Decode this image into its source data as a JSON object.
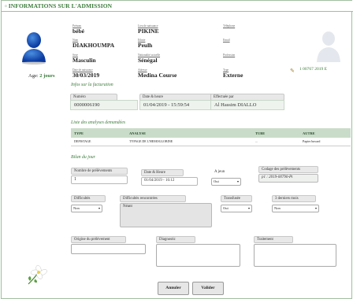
{
  "header": {
    "title": "INFORMATIONS SUR L'ADMISSION",
    "marker": "▫"
  },
  "patient": {
    "age_label": "Age:",
    "age_value": "2 jours",
    "ident_code": "1 00767 2019 E",
    "fields": [
      {
        "label": "Prénom",
        "value": "bébé"
      },
      {
        "label": "Lieu de naissance",
        "value": "PIKINE"
      },
      {
        "label": "Téléphone",
        "value": ""
      },
      {
        "label": "Nom",
        "value": "DIAKHOUMPA"
      },
      {
        "label": "Ethnie",
        "value": "Peulh"
      },
      {
        "label": "Email",
        "value": ""
      },
      {
        "label": "Sexe",
        "value": "Masculin"
      },
      {
        "label": "Nationalité actuelle",
        "value": "Sénégal"
      },
      {
        "label": "Profession",
        "value": ""
      },
      {
        "label": "Date de naissance",
        "value": "30/03/2019"
      },
      {
        "label": "Adresse",
        "value": "Medina Course"
      },
      {
        "label": "Type",
        "value": "Externe"
      }
    ]
  },
  "facturation": {
    "section_title": "Infos sur la facturation",
    "numero_label": "Numéro",
    "numero_value": "0000006190",
    "date_label": "Date & heure",
    "date_value": "01/04/2019 - 15:59:54",
    "effectue_label": "Effectuée par",
    "effectue_value": "Al Hassim DIALLO"
  },
  "analyses": {
    "section_title": "Liste des analyses demandées",
    "columns": [
      "TYPE",
      "ANALYSE",
      "TUBE",
      "AUTRE"
    ],
    "rows": [
      [
        "DEPISTAGE",
        "TYPAGE DE L'HEMOGLOBINE",
        "...",
        "Papier buvard"
      ]
    ]
  },
  "bilan": {
    "section_title": "Bilan du jour",
    "nombre_label": "Nombre de prélèvements",
    "nombre_value": "1",
    "date_label": "Date & Heure",
    "date_value": "01/04/2019 - 16:12",
    "ajeun_label": "A jeun",
    "ajeun_value": "Oui",
    "codage_label": "Codage des prélèvements",
    "codage_value": "p1 : 2019-00790-Pt",
    "difficultes_label": "Difficultés",
    "difficultes_value": "Non",
    "difficultes_rencontrees_label": "Difficultés rencontrées",
    "difficultes_rencontrees_value": "Néant",
    "transfusee_label": "Transfusée",
    "transfusee_value": "Oui",
    "mois_label": "3 derniers mois",
    "mois_value": "Non",
    "origine_label": "Origine du prélèvement",
    "diagnostic_label": "Diagnostic",
    "traitement_label": "Traitement"
  },
  "actions": {
    "cancel_label": "Annuler",
    "submit_label": "Valider"
  },
  "colors": {
    "accent": "#3a7a3a",
    "border": "#9fbf9f"
  }
}
